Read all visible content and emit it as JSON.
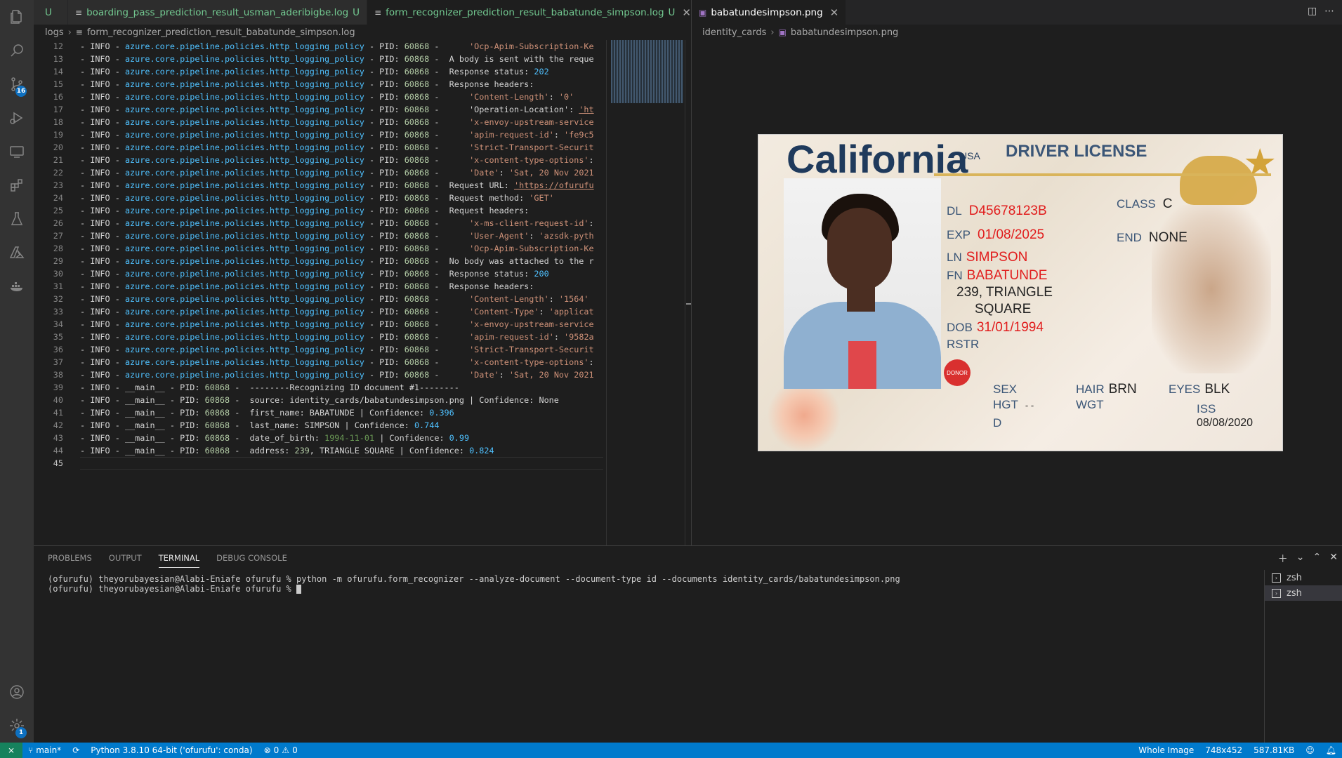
{
  "left_tabs": [
    {
      "name": "",
      "mod": "U",
      "active": false
    },
    {
      "name": "boarding_pass_prediction_result_usman_aderibigbe.log",
      "mod": "U",
      "active": false
    },
    {
      "name": "form_recognizer_prediction_result_babatunde_simpson.log",
      "mod": "U",
      "active": true
    }
  ],
  "more_tabs_icon": "ellipsis-icon",
  "right_tab": {
    "name": "babatundesimpson.png"
  },
  "left_breadcrumb": {
    "folder": "logs",
    "file": "form_recognizer_prediction_result_babatunde_simpson.log"
  },
  "right_breadcrumb": {
    "folder": "identity_cards",
    "file": "babatundesimpson.png"
  },
  "log_lines": [
    {
      "n": "12",
      "kind": "az",
      "rest": "    'Ocp-Apim-Subscription-Ke"
    },
    {
      "n": "13",
      "kind": "az",
      "rest": "A body is sent with the reque"
    },
    {
      "n": "14",
      "kind": "az",
      "rest": "Response status: ",
      "num": "202"
    },
    {
      "n": "15",
      "kind": "az",
      "rest": "Response headers:"
    },
    {
      "n": "16",
      "kind": "az",
      "rest": "    'Content-Length': '0'"
    },
    {
      "n": "17",
      "kind": "az",
      "rest": "    'Operation-Location': 'ht"
    },
    {
      "n": "18",
      "kind": "az",
      "rest": "    'x-envoy-upstream-service"
    },
    {
      "n": "19",
      "kind": "az",
      "rest": "    'apim-request-id': 'fe9c5"
    },
    {
      "n": "20",
      "kind": "az",
      "rest": "    'Strict-Transport-Securit"
    },
    {
      "n": "21",
      "kind": "az",
      "rest": "    'x-content-type-options':"
    },
    {
      "n": "22",
      "kind": "az",
      "rest": "    'Date': 'Sat, 20 Nov 2021"
    },
    {
      "n": "23",
      "kind": "az",
      "rest": "Request URL: 'https://ofurufu"
    },
    {
      "n": "24",
      "kind": "az",
      "rest": "Request method: 'GET'"
    },
    {
      "n": "25",
      "kind": "az",
      "rest": "Request headers:"
    },
    {
      "n": "26",
      "kind": "az",
      "rest": "    'x-ms-client-request-id':"
    },
    {
      "n": "27",
      "kind": "az",
      "rest": "    'User-Agent': 'azsdk-pyth"
    },
    {
      "n": "28",
      "kind": "az",
      "rest": "    'Ocp-Apim-Subscription-Ke"
    },
    {
      "n": "29",
      "kind": "az",
      "rest": "No body was attached to the r"
    },
    {
      "n": "30",
      "kind": "az",
      "rest": "Response status: ",
      "num": "200"
    },
    {
      "n": "31",
      "kind": "az",
      "rest": "Response headers:"
    },
    {
      "n": "32",
      "kind": "az",
      "rest": "    'Content-Length': '1564'"
    },
    {
      "n": "33",
      "kind": "az",
      "rest": "    'Content-Type': 'applicat"
    },
    {
      "n": "34",
      "kind": "az",
      "rest": "    'x-envoy-upstream-service"
    },
    {
      "n": "35",
      "kind": "az",
      "rest": "    'apim-request-id': '9582a"
    },
    {
      "n": "36",
      "kind": "az",
      "rest": "    'Strict-Transport-Securit"
    },
    {
      "n": "37",
      "kind": "az",
      "rest": "    'x-content-type-options':"
    },
    {
      "n": "38",
      "kind": "az",
      "rest": "    'Date': 'Sat, 20 Nov 2021"
    },
    {
      "n": "39",
      "kind": "main",
      "rest": "--------Recognizing ID document #1--------"
    },
    {
      "n": "40",
      "kind": "main",
      "rest": "source: identity_cards/babatundesimpson.png | Confidence: None"
    },
    {
      "n": "41",
      "kind": "main",
      "rest": "first_name: BABATUNDE | Confidence: ",
      "num": "0.396"
    },
    {
      "n": "42",
      "kind": "main",
      "rest": "last_name: SIMPSON | Confidence: ",
      "num": "0.744"
    },
    {
      "n": "43",
      "kind": "main",
      "rest": "date_of_birth: ",
      "date": "1994-11-01",
      "rest2": " | Confidence: ",
      "num": "0.99"
    },
    {
      "n": "44",
      "kind": "main",
      "rest": "address: ",
      "num0": "239",
      "rest2": ", TRIANGLE SQUARE | Confidence: ",
      "num": "0.824"
    },
    {
      "n": "45",
      "kind": "empty",
      "rest": ""
    }
  ],
  "log_prefix": {
    "dash": "- ",
    "info": "INFO",
    "sep": " - ",
    "az_module": "azure.core.pipeline.policies.http_logging_policy",
    "main_module": "__main__",
    "pid_label": "PID: ",
    "pid": "60868",
    "tail": " -  "
  },
  "card": {
    "title": "California",
    "usa": "USA",
    "heading": "DRIVER LICENSE",
    "dl_label": "DL",
    "dl": "D45678123B",
    "exp_label": "EXP",
    "exp": "01/08/2025",
    "ln_label": "LN",
    "ln": "SIMPSON",
    "fn_label": "FN",
    "fn": "BABATUNDE",
    "addr1": "239, TRIANGLE",
    "addr2": "SQUARE",
    "dob_label": "DOB",
    "dob": "31/01/1994",
    "rstr_label": "RSTR",
    "class_label": "CLASS",
    "class": "C",
    "end_label": "END",
    "end": "NONE",
    "donor": "DONOR",
    "sex_label": "SEX",
    "hgt_label": "HGT",
    "hgt": "- -",
    "d_label": "D",
    "hair_label": "HAIR",
    "hair": "BRN",
    "wgt_label": "WGT",
    "eyes_label": "EYES",
    "eyes": "BLK",
    "iss_label": "ISS",
    "iss": "08/08/2020"
  },
  "panel": {
    "tabs": [
      "PROBLEMS",
      "OUTPUT",
      "TERMINAL",
      "DEBUG CONSOLE"
    ],
    "active_tab": "TERMINAL",
    "terminal_lines": [
      "(ofurufu) theyorubayesian@Alabi-Eniafe ofurufu % python -m ofurufu.form_recognizer --analyze-document --document-type id --documents identity_cards/babatundesimpson.png",
      "(ofurufu) theyorubayesian@Alabi-Eniafe ofurufu % "
    ],
    "terminals": [
      "zsh",
      "zsh"
    ]
  },
  "status": {
    "branch": "main*",
    "python": "Python 3.8.10 64-bit ('ofurufu': conda)",
    "errors": "0",
    "warnings": "0",
    "zoom": "Whole Image",
    "dims": "748x452",
    "size": "587.81KB"
  },
  "activity": {
    "scm_badge": "16",
    "settings_badge": "1"
  }
}
